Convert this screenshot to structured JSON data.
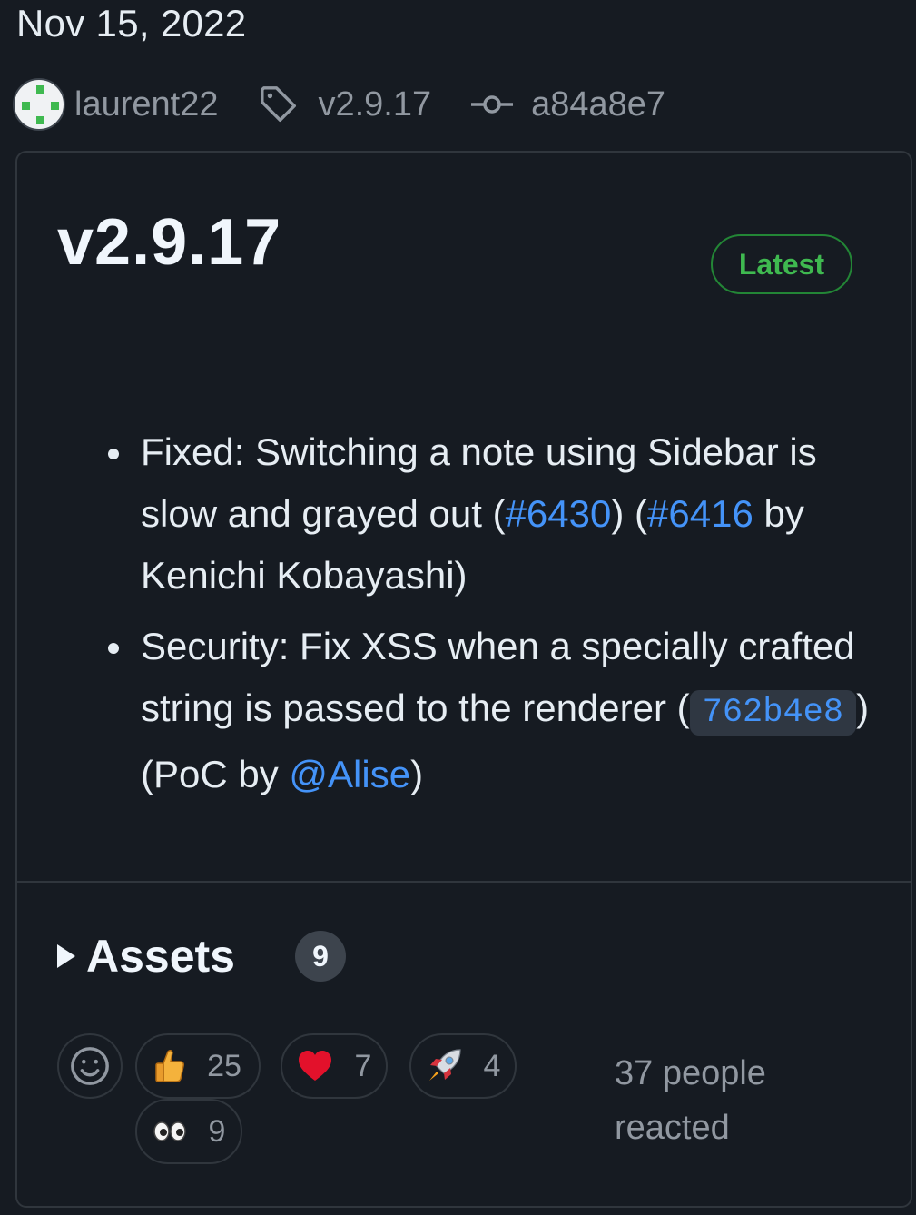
{
  "date": "Nov 15, 2022",
  "meta": {
    "author": "laurent22",
    "tag": "v2.9.17",
    "commit": "a84a8e7"
  },
  "release": {
    "title": "v2.9.17",
    "badge": "Latest",
    "notes": {
      "item1": {
        "prefix": "Fixed: Switching a note using Sidebar is slow and grayed out (",
        "link1": "#6430",
        "mid": ") (",
        "link2": "#6416",
        "suffix": " by Kenichi Kobayashi)"
      },
      "item2": {
        "prefix": "Security: Fix XSS when a specially crafted string is passed to the renderer (",
        "code": "762b4e8",
        "mid": ") (PoC by ",
        "mention": "@Alise",
        "suffix": ")"
      }
    }
  },
  "assets": {
    "label": "Assets",
    "count": "9"
  },
  "reactions": {
    "thumbs_up": "25",
    "heart": "7",
    "rocket": "4",
    "eyes": "9",
    "summary": "37 people reacted"
  }
}
